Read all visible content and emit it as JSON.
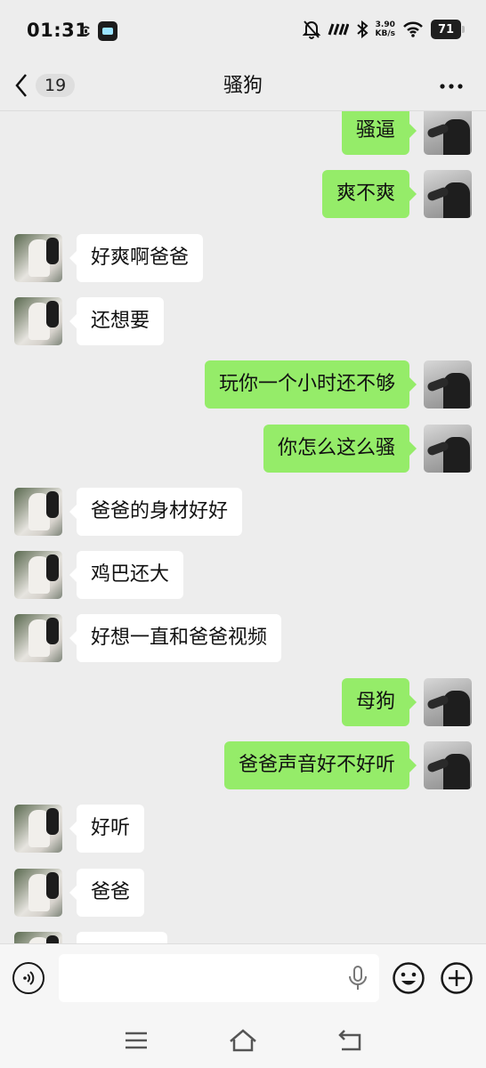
{
  "status_bar": {
    "time": "01:31",
    "net_speed_value": "3.90",
    "net_speed_unit": "KB/s",
    "battery_level": "71",
    "left_icons": [
      "sync-icon",
      "app-notification-icon"
    ],
    "right_icons": [
      "mute-bell-icon",
      "signal-icon",
      "bluetooth-icon",
      "wifi-icon",
      "battery-icon"
    ]
  },
  "header": {
    "unread_count": "19",
    "title": "骚狗"
  },
  "messages": [
    {
      "side": "right",
      "text": "骚逼"
    },
    {
      "side": "right",
      "text": "爽不爽"
    },
    {
      "side": "left",
      "text": "好爽啊爸爸"
    },
    {
      "side": "left",
      "text": "还想要"
    },
    {
      "side": "right",
      "text": "玩你一个小时还不够"
    },
    {
      "side": "right",
      "text": "你怎么这么骚"
    },
    {
      "side": "left",
      "text": "爸爸的身材好好"
    },
    {
      "side": "left",
      "text": "鸡巴还大"
    },
    {
      "side": "left",
      "text": "好想一直和爸爸视频"
    },
    {
      "side": "right",
      "text": "母狗"
    },
    {
      "side": "right",
      "text": "爸爸声音好不好听"
    },
    {
      "side": "left",
      "text": "好听"
    },
    {
      "side": "left",
      "text": "爸爸"
    },
    {
      "side": "left",
      "text": ""
    }
  ],
  "input_bar": {
    "value": "",
    "placeholder": ""
  },
  "colors": {
    "background": "#ededed",
    "outgoing_bubble": "#95ec69",
    "incoming_bubble": "#ffffff"
  }
}
